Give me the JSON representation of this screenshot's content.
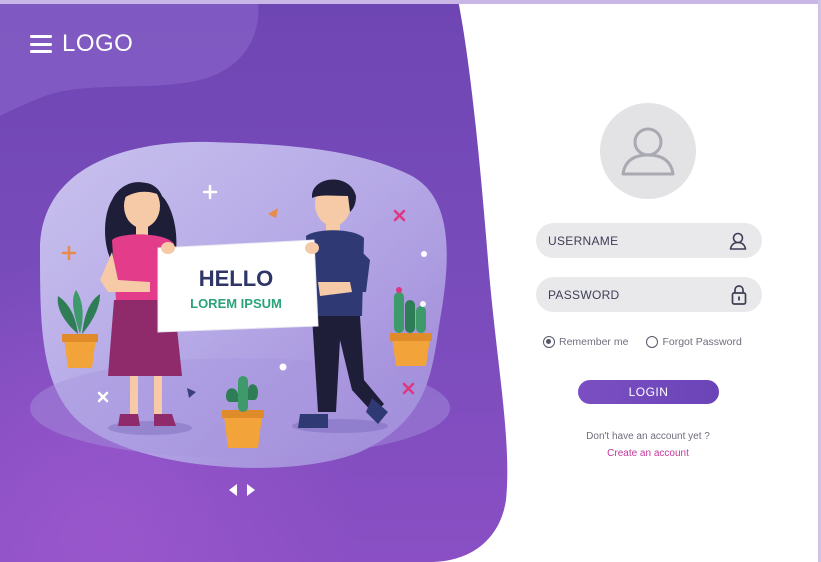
{
  "brand": {
    "logo_text": "LOGO"
  },
  "illustration": {
    "sign_title": "HELLO",
    "sign_subtitle": "LOREM IPSUM"
  },
  "login": {
    "username": {
      "placeholder": "USERNAME",
      "icon": "user-icon"
    },
    "password": {
      "placeholder": "PASSWORD",
      "icon": "lock-icon"
    },
    "remember_label": "Remember me",
    "remember_checked": true,
    "forgot_label": "Forgot Password",
    "login_button": "LOGIN",
    "signup_question": "Don't have an account yet ?",
    "signup_link": "Create an account"
  },
  "colors": {
    "primary": "#6b44b8",
    "accent_link": "#c2379b",
    "background_right": "#ffffff"
  }
}
